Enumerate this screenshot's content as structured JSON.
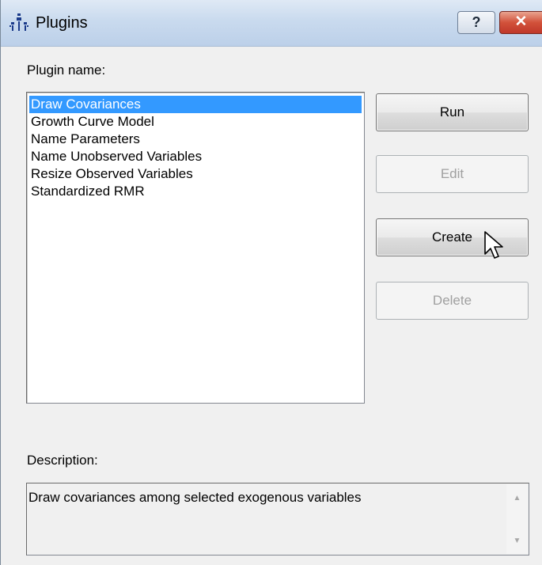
{
  "window": {
    "title": "Plugins",
    "help_label": "?",
    "close_label": "✕"
  },
  "plugin_list": {
    "label": "Plugin name:",
    "items": [
      {
        "label": "Draw Covariances",
        "selected": true
      },
      {
        "label": "Growth Curve Model",
        "selected": false
      },
      {
        "label": "Name Parameters",
        "selected": false
      },
      {
        "label": "Name Unobserved Variables",
        "selected": false
      },
      {
        "label": "Resize Observed Variables",
        "selected": false
      },
      {
        "label": "Standardized RMR",
        "selected": false
      }
    ]
  },
  "buttons": {
    "run": {
      "label": "Run",
      "enabled": true
    },
    "edit": {
      "label": "Edit",
      "enabled": false
    },
    "create": {
      "label": "Create",
      "enabled": true
    },
    "delete": {
      "label": "Delete",
      "enabled": false
    }
  },
  "description": {
    "label": "Description:",
    "text": "Draw covariances among selected exogenous variables"
  },
  "colors": {
    "selection": "#3399ff",
    "close_button": "#c8402f"
  },
  "icons": {
    "app": "plugins-app-icon",
    "cursor": "mouse-pointer-icon"
  }
}
